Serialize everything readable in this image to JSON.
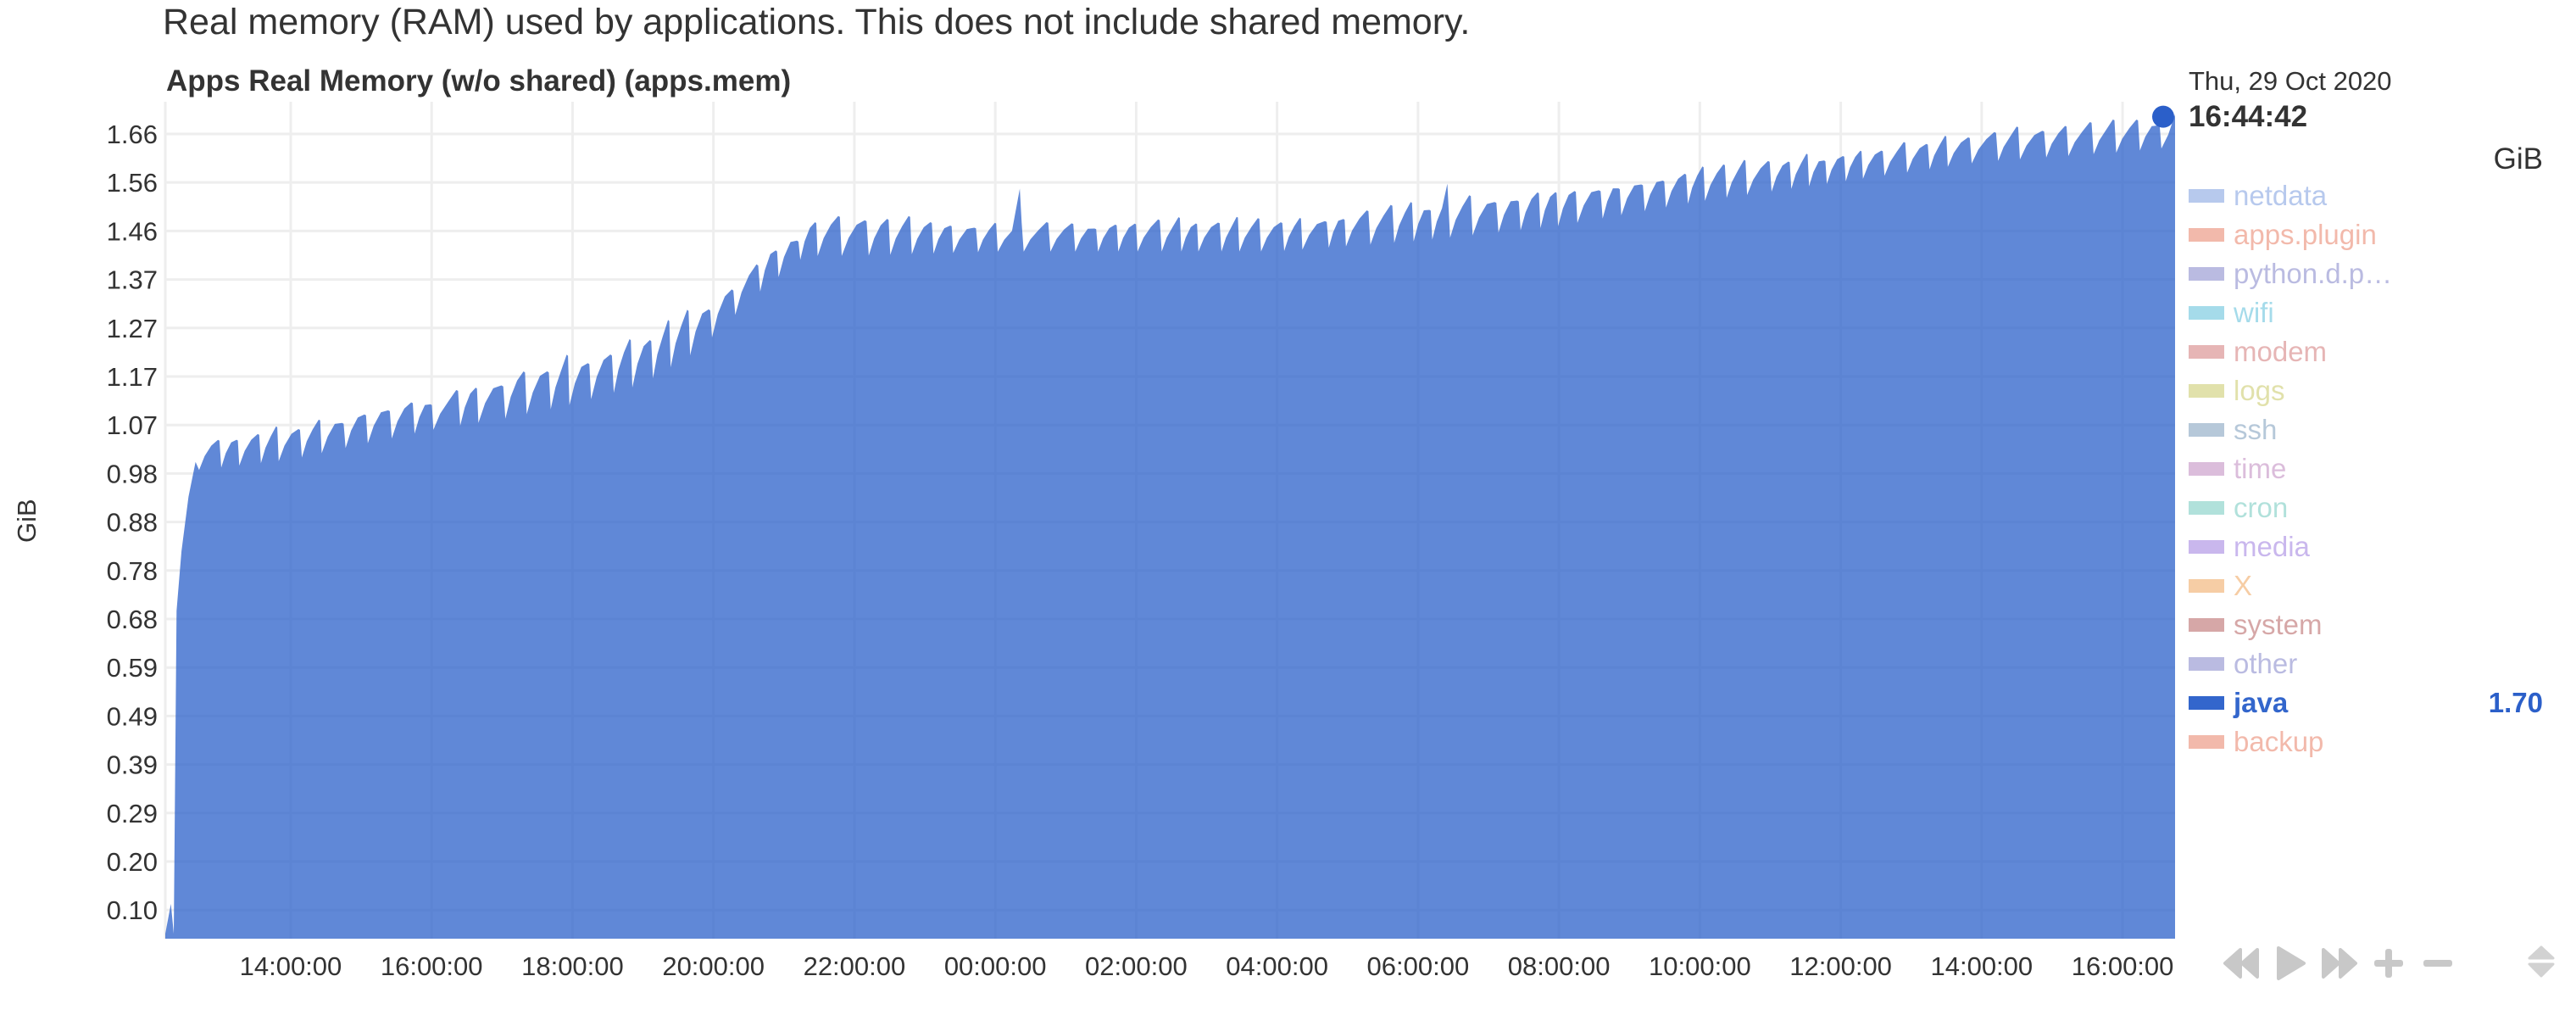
{
  "description": "Real memory (RAM) used by applications. This does not include shared memory.",
  "chart_title": "Apps Real Memory (w/o shared) (apps.mem)",
  "y_unit": "GiB",
  "legend": {
    "date": "Thu, 29 Oct 2020",
    "time": "16:44:42",
    "unit": "GiB",
    "items": [
      {
        "label": "netdata",
        "color": "#3366cc",
        "active": false,
        "value": null
      },
      {
        "label": "apps.plugin",
        "color": "#dc3912",
        "active": false,
        "value": null
      },
      {
        "label": "python.d.p…",
        "color": "#3b3eac",
        "active": false,
        "value": null
      },
      {
        "label": "wifi",
        "color": "#0099c6",
        "active": false,
        "value": null
      },
      {
        "label": "modem",
        "color": "#b82e2e",
        "active": false,
        "value": null
      },
      {
        "label": "logs",
        "color": "#aaaa11",
        "active": false,
        "value": null
      },
      {
        "label": "ssh",
        "color": "#316395",
        "active": false,
        "value": null
      },
      {
        "label": "time",
        "color": "#994499",
        "active": false,
        "value": null
      },
      {
        "label": "cron",
        "color": "#22aa99",
        "active": false,
        "value": null
      },
      {
        "label": "media",
        "color": "#6633cc",
        "active": false,
        "value": null
      },
      {
        "label": "X",
        "color": "#e67300",
        "active": false,
        "value": null
      },
      {
        "label": "system",
        "color": "#8b0707",
        "active": false,
        "value": null
      },
      {
        "label": "other",
        "color": "#3b3eac",
        "active": false,
        "value": null
      },
      {
        "label": "java",
        "color": "#3366cc",
        "active": true,
        "value": "1.70"
      },
      {
        "label": "backup",
        "color": "#dc3912",
        "active": false,
        "value": null
      }
    ]
  },
  "controls": [
    "rewind-icon",
    "play-icon",
    "fast-forward-icon",
    "zoom-in-icon",
    "zoom-out-icon"
  ],
  "chart_data": {
    "type": "area",
    "title": "Apps Real Memory (w/o shared) (apps.mem)",
    "xlabel": "",
    "ylabel": "GiB",
    "series_name": "java",
    "fill_color": "#3366cc",
    "x_unit": "hours since 00:00 Wed 28 Oct 2020",
    "xlim": [
      12.22,
      40.745
    ],
    "ylim": [
      0.04,
      1.725
    ],
    "grid": true,
    "legend_position": "right",
    "x_ticks": [
      {
        "x": 14,
        "label": "14:00:00"
      },
      {
        "x": 16,
        "label": "16:00:00"
      },
      {
        "x": 18,
        "label": "18:00:00"
      },
      {
        "x": 20,
        "label": "20:00:00"
      },
      {
        "x": 22,
        "label": "22:00:00"
      },
      {
        "x": 24,
        "label": "00:00:00"
      },
      {
        "x": 26,
        "label": "02:00:00"
      },
      {
        "x": 28,
        "label": "04:00:00"
      },
      {
        "x": 30,
        "label": "06:00:00"
      },
      {
        "x": 32,
        "label": "08:00:00"
      },
      {
        "x": 34,
        "label": "10:00:00"
      },
      {
        "x": 36,
        "label": "12:00:00"
      },
      {
        "x": 38,
        "label": "14:00:00"
      },
      {
        "x": 40,
        "label": "16:00:00"
      }
    ],
    "y_ticks": [
      {
        "y": 0.0977,
        "label": "0.10"
      },
      {
        "y": 0.1953,
        "label": "0.20"
      },
      {
        "y": 0.293,
        "label": "0.29"
      },
      {
        "y": 0.3906,
        "label": "0.39"
      },
      {
        "y": 0.4883,
        "label": "0.49"
      },
      {
        "y": 0.5859,
        "label": "0.59"
      },
      {
        "y": 0.6836,
        "label": "0.68"
      },
      {
        "y": 0.7813,
        "label": "0.78"
      },
      {
        "y": 0.8789,
        "label": "0.88"
      },
      {
        "y": 0.9766,
        "label": "0.98"
      },
      {
        "y": 1.0742,
        "label": "1.07"
      },
      {
        "y": 1.1719,
        "label": "1.17"
      },
      {
        "y": 1.2695,
        "label": "1.27"
      },
      {
        "y": 1.3672,
        "label": "1.37"
      },
      {
        "y": 1.4648,
        "label": "1.46"
      },
      {
        "y": 1.5625,
        "label": "1.56"
      },
      {
        "y": 1.6602,
        "label": "1.66"
      }
    ],
    "startup": [
      [
        12.22,
        0.05
      ],
      [
        12.3,
        0.11
      ],
      [
        12.34,
        0.05
      ],
      [
        12.38,
        0.7
      ],
      [
        12.45,
        0.82
      ],
      [
        12.55,
        0.93
      ],
      [
        12.65,
        1.0
      ]
    ],
    "envelope": [
      {
        "x": 12.7,
        "low": 0.98,
        "high": 1.05
      },
      {
        "x": 14.0,
        "low": 1.0,
        "high": 1.08
      },
      {
        "x": 15.0,
        "low": 1.03,
        "high": 1.12
      },
      {
        "x": 16.0,
        "low": 1.06,
        "high": 1.14
      },
      {
        "x": 17.0,
        "low": 1.08,
        "high": 1.19
      },
      {
        "x": 18.0,
        "low": 1.11,
        "high": 1.22
      },
      {
        "x": 19.0,
        "low": 1.15,
        "high": 1.27
      },
      {
        "x": 19.8,
        "low": 1.22,
        "high": 1.34
      },
      {
        "x": 20.6,
        "low": 1.33,
        "high": 1.44
      },
      {
        "x": 21.3,
        "low": 1.41,
        "high": 1.5
      },
      {
        "x": 22.0,
        "low": 1.41,
        "high": 1.5
      },
      {
        "x": 24.0,
        "low": 1.42,
        "high": 1.48
      },
      {
        "x": 26.0,
        "low": 1.42,
        "high": 1.49
      },
      {
        "x": 28.0,
        "low": 1.42,
        "high": 1.49
      },
      {
        "x": 30.0,
        "low": 1.44,
        "high": 1.53
      },
      {
        "x": 32.0,
        "low": 1.47,
        "high": 1.56
      },
      {
        "x": 34.0,
        "low": 1.52,
        "high": 1.6
      },
      {
        "x": 36.0,
        "low": 1.56,
        "high": 1.63
      },
      {
        "x": 38.0,
        "low": 1.6,
        "high": 1.67
      },
      {
        "x": 40.0,
        "low": 1.62,
        "high": 1.69
      },
      {
        "x": 40.745,
        "low": 1.63,
        "high": 1.7
      }
    ],
    "period_hours": 0.3,
    "spikes": [
      {
        "x": 24.3,
        "y": 1.55
      },
      {
        "x": 30.4,
        "y": 1.56
      }
    ],
    "last_value": {
      "x": 40.745,
      "y": 1.7,
      "label": "1.70"
    }
  }
}
